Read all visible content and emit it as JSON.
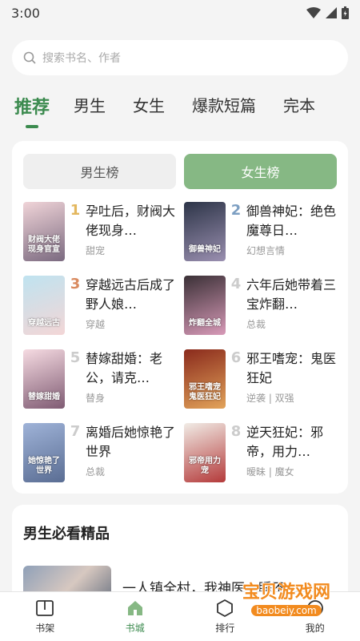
{
  "status_bar": {
    "time": "3:00"
  },
  "search": {
    "placeholder": "搜索书名、作者"
  },
  "tabs": [
    {
      "label": "推荐",
      "active": true
    },
    {
      "label": "男生"
    },
    {
      "label": "女生"
    },
    {
      "label": "爆款短篇"
    },
    {
      "label": "完本"
    }
  ],
  "ranking": {
    "toggle_male": "男生榜",
    "toggle_female": "女生榜",
    "items": [
      {
        "rank": "1",
        "title": "孕吐后，财阀大佬现身…",
        "tag": "甜宠",
        "cover_text": "财阀大佬现身官宣",
        "rank_color": "#e3b75e",
        "cover_colors": [
          "#f0d4d8",
          "#7b6a80"
        ]
      },
      {
        "rank": "2",
        "title": "御兽神妃：绝色魔尊日…",
        "tag": "幻想言情",
        "cover_text": "御兽神妃",
        "rank_color": "#7d9fc2",
        "cover_colors": [
          "#2d3548",
          "#9a8fb0"
        ]
      },
      {
        "rank": "3",
        "title": "穿越远古后成了野人娘…",
        "tag": "穿越",
        "cover_text": "穿越远古",
        "rank_color": "#d98a5f",
        "cover_colors": [
          "#bfe3f0",
          "#f3d6d6"
        ]
      },
      {
        "rank": "4",
        "title": "六年后她带着三宝炸翻…",
        "tag": "总裁",
        "cover_text": "炸翻全城",
        "rank_color": "#cccccc",
        "cover_colors": [
          "#3a3036",
          "#d89ab8"
        ]
      },
      {
        "rank": "5",
        "title": "替嫁甜婚：老公，请克…",
        "tag": "替身",
        "cover_text": "替嫁甜婚",
        "rank_color": "#cccccc",
        "cover_colors": [
          "#f6dbe2",
          "#7f5b73"
        ]
      },
      {
        "rank": "6",
        "title": "邪王嗜宠：鬼医狂妃",
        "tag": "逆袭 | 双强",
        "cover_text": "邪王嗜宠鬼医狂妃",
        "rank_color": "#cccccc",
        "cover_colors": [
          "#8a2a1c",
          "#e2a35a"
        ]
      },
      {
        "rank": "7",
        "title": "离婚后她惊艳了世界",
        "tag": "总裁",
        "cover_text": "她惊艳了世界",
        "rank_color": "#cccccc",
        "cover_colors": [
          "#9fb3d8",
          "#5a6d93"
        ]
      },
      {
        "rank": "8",
        "title": "逆天狂妃：邪帝，用力…",
        "tag": "暧昧 | 魔女",
        "cover_text": "邪帝用力宠",
        "rank_color": "#cccccc",
        "cover_colors": [
          "#f1ece6",
          "#b43a3a"
        ]
      }
    ]
  },
  "male_section": {
    "title": "男生必看精品",
    "featured_title": "一人镇全村，我神医一睡不…"
  },
  "bottom_nav": [
    {
      "label": "书架",
      "icon": "bookshelf-icon"
    },
    {
      "label": "书城",
      "icon": "bookstore-icon",
      "active": true
    },
    {
      "label": "排行",
      "icon": "ranking-icon"
    },
    {
      "label": "我的",
      "icon": "profile-icon"
    }
  ],
  "watermark": {
    "main": "宝贝游戏网",
    "sub": "baobeiy.com"
  },
  "colors": {
    "accent": "#3b8a4e",
    "toggle_on": "#86b884",
    "background": "#f4f4f4"
  }
}
